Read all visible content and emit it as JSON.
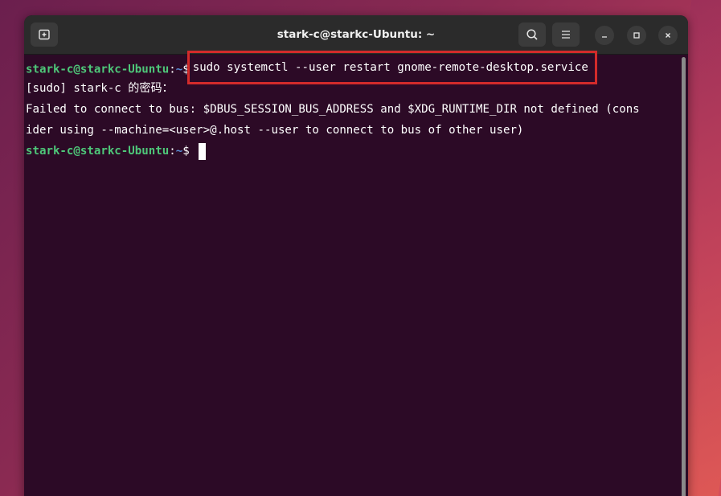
{
  "window": {
    "title": "stark-c@starkc-Ubuntu: ~"
  },
  "icons": {
    "new_tab": "new-tab-icon",
    "search": "search-icon",
    "menu": "hamburger-menu-icon",
    "minimize": "minimize-icon",
    "maximize": "maximize-icon",
    "close": "close-icon"
  },
  "terminal": {
    "prompt_user": "stark-c@starkc-Ubuntu",
    "prompt_colon": ":",
    "prompt_path": "~",
    "prompt_dollar": "$",
    "command": "sudo systemctl --user restart gnome-remote-desktop.service",
    "sudo_prompt": "[sudo] stark-c 的密码：",
    "error_line_1": "Failed to connect to bus: $DBUS_SESSION_BUS_ADDRESS and $XDG_RUNTIME_DIR not defined (cons",
    "error_line_2": "ider using --machine=<user>@.host --user to connect to bus of other user)"
  },
  "colors": {
    "terminal_bg": "#2c0a26",
    "prompt_user": "#4ec779",
    "prompt_path": "#5a8fd6",
    "highlight_box": "#d32b2b"
  }
}
